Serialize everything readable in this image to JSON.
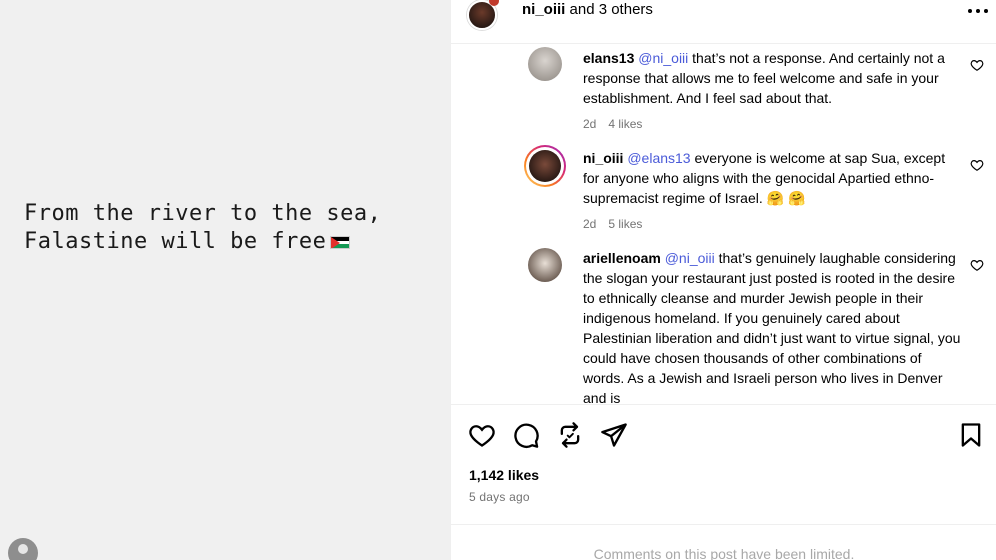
{
  "post": {
    "text_line1": "From the river to the sea,",
    "text_line2": "Falastine will be free",
    "flag_icon": "palestine-flag-icon"
  },
  "header": {
    "username": "ni_oiii",
    "others": " and 3 others",
    "more_icon": "more-horizontal-icon"
  },
  "comments": [
    {
      "user": "elans13",
      "mention": "@ni_oiii",
      "text": " that’s not a response. And certainly not a response that allows me to feel welcome and safe in your establishment. And I feel sad about that.",
      "age": "2d",
      "likes": "4 likes"
    },
    {
      "user": "ni_oiii",
      "mention": "@elans13",
      "text": " everyone is welcome at sap Sua, except for anyone who aligns with the genocidal Apartied ethno-supremacist regime of Israel. 🤗 🤗",
      "age": "2d",
      "likes": "5 likes"
    },
    {
      "user": "ariellenoam",
      "mention": "@ni_oiii",
      "text": " that’s genuinely laughable considering the slogan your restaurant just posted is rooted in the desire to ethnically cleanse and murder Jewish people in their indigenous homeland. If you genuinely cared about Palestinian liberation and didn’t just want to virtue signal, you could have chosen thousands of other combinations of words. As a Jewish and Israeli person who lives in Denver and is"
    }
  ],
  "actions": {
    "like_icon": "heart-icon",
    "comment_icon": "comment-icon",
    "repost_icon": "repost-icon",
    "share_icon": "share-icon",
    "save_icon": "bookmark-icon"
  },
  "likes_count": "1,142 likes",
  "time_ago": "5 days ago",
  "comments_limited": "Comments on this post have been limited."
}
